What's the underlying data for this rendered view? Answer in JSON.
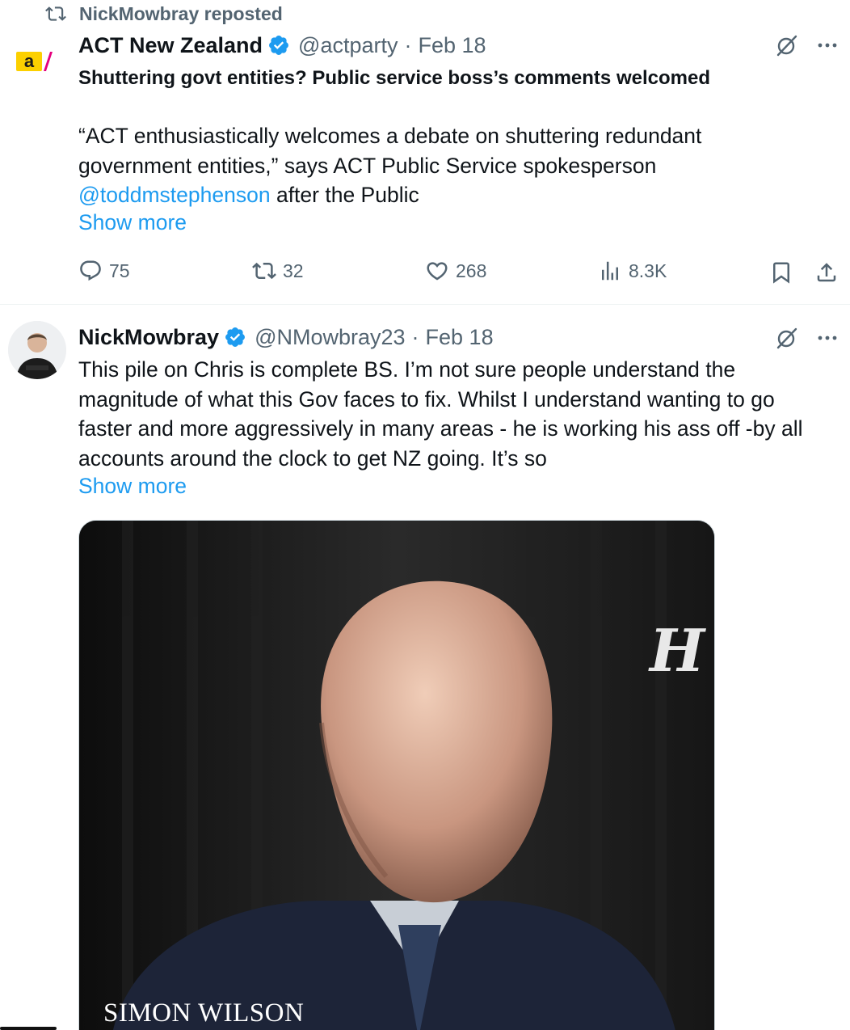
{
  "repost": {
    "label": "NickMowbray reposted"
  },
  "tweet1": {
    "display_name": "ACT New Zealand",
    "handle": "@actparty",
    "separator": "·",
    "date": "Feb 18",
    "headline": "Shuttering govt entities? Public service boss’s comments welcomed",
    "body_part1": "“ACT enthusiastically welcomes a debate on shuttering redundant\ngovernment entities,” says ACT Public Service spokesperson",
    "mention": "@toddmstephenson",
    "body_part2": " after the Public",
    "show_more": "Show more",
    "replies": "75",
    "reposts": "32",
    "likes": "268",
    "views": "8.3K",
    "avatar_text": "a/"
  },
  "tweet2": {
    "display_name": "NickMowbray",
    "handle": "@NMowbray23",
    "separator": "·",
    "date": "Feb 18",
    "body": "This pile on Chris is complete BS. I’m not sure people understand the\nmagnitude of what this Gov faces to fix. Whilst I  understand wanting to go\nfaster and more aggressively in many areas - he is working his ass off -by all\naccounts around the clock to get NZ going.  It’s so",
    "show_more": "Show more",
    "media_caption": "SIMON WILSON",
    "media_mark": "H"
  },
  "colors": {
    "link": "#1d9bf0",
    "secondary_text": "#536471",
    "verified": "#1d9bf0",
    "act_yellow": "#fcd000",
    "act_pink": "#e5007e"
  }
}
